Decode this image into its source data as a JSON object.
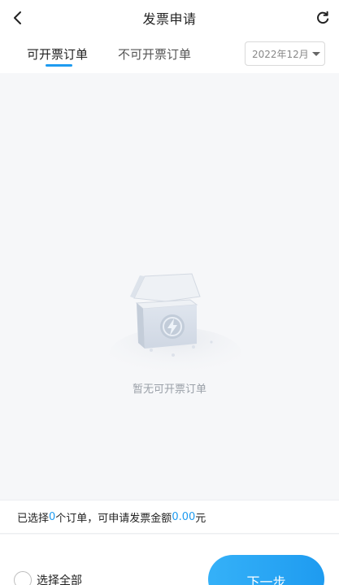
{
  "header": {
    "title": "发票申请",
    "back_icon": "chevron-left-icon",
    "refresh_icon": "refresh-icon"
  },
  "tabs": [
    {
      "label": "可开票订单",
      "active": true
    },
    {
      "label": "不可开票订单",
      "active": false
    }
  ],
  "month_picker": {
    "value": "2022年12月",
    "icon": "caret-down-icon"
  },
  "empty_state": {
    "icon": "empty-box-icon",
    "text": "暂无可开票订单"
  },
  "summary": {
    "prefix": "已选择",
    "count": "0",
    "middle": "个订单，可申请发票金额",
    "amount": "0.00",
    "suffix": "元"
  },
  "footer": {
    "select_all_label": "选择全部",
    "next_label": "下一步"
  },
  "colors": {
    "accent": "#1e9bf0",
    "background": "#f6f7f9"
  }
}
